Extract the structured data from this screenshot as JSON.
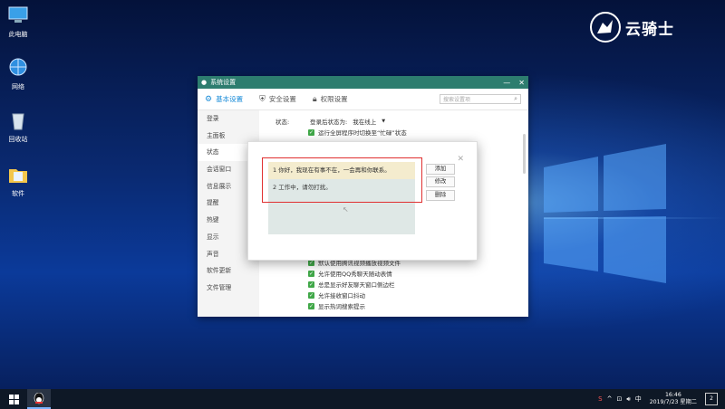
{
  "desktop": {
    "icons": [
      {
        "label": "此电脑",
        "icon": "computer-icon"
      },
      {
        "label": "网络",
        "icon": "network-icon"
      },
      {
        "label": "回收站",
        "icon": "recycle-bin-icon"
      },
      {
        "label": "软件",
        "icon": "folder-icon"
      }
    ],
    "brand": "云骑士"
  },
  "settings_window": {
    "title": "系统设置",
    "tabs": [
      {
        "label": "基本设置",
        "icon": "gear-icon",
        "active": true
      },
      {
        "label": "安全设置",
        "icon": "shield-icon",
        "active": false
      },
      {
        "label": "权限设置",
        "icon": "lock-icon",
        "active": false
      }
    ],
    "search_placeholder": "搜索设置项",
    "sidebar": [
      "登录",
      "主面板",
      "状态",
      "会话窗口",
      "信息展示",
      "提醒",
      "热键",
      "显示",
      "声音",
      "软件更新",
      "文件管理"
    ],
    "active_sidebar_index": 2,
    "status_label": "状态:",
    "login_status_label": "登录后状态为:",
    "login_status_value": "我在线上",
    "top_option": "运行全屏程序时切换至“忙碌”状态",
    "lower_options": [
      "默认使用腾讯视频播放视频文件",
      "允许使用QQ秀聊天随动表情",
      "总是显示好友聊天窗口侧边栏",
      "允许接收窗口抖动",
      "显示热词搜索提示"
    ]
  },
  "auto_reply_dialog": {
    "items": [
      "1  你好，我现在有事不在，一会再和你联系。",
      "2  工作中，请勿打扰。"
    ],
    "selected_index": 0,
    "buttons": {
      "add": "添加",
      "edit": "修改",
      "delete": "删除"
    }
  },
  "taskbar": {
    "time": "16:46",
    "date": "2019/7/23 星期二",
    "lang": "中",
    "notification_count": "2"
  },
  "colors": {
    "titlebar": "#2d7d6f",
    "accent": "#1a8cd8",
    "checkbox": "#41a849",
    "highlight_box": "#e03030"
  }
}
